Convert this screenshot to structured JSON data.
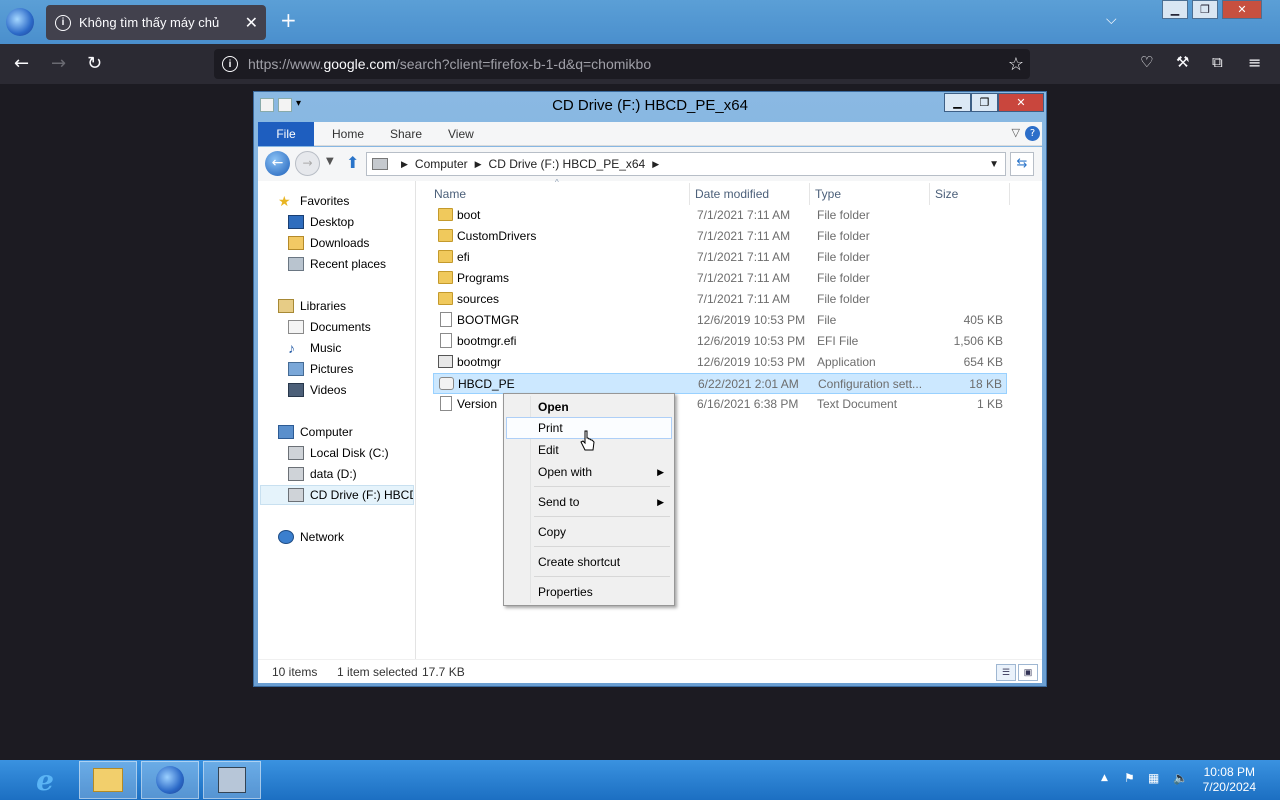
{
  "browser": {
    "tab_title": "Không tìm thấy máy chủ",
    "tab_close": "✕",
    "new_tab": "+",
    "url_prefix": "https://www.",
    "url_domain": "google.com",
    "url_path": "/search?client=firefox-b-1-d&q=chomikbo"
  },
  "window": {
    "title": "CD Drive (F:) HBCD_PE_x64",
    "ribbon_tabs": [
      "File",
      "Home",
      "Share",
      "View"
    ],
    "breadcrumb": [
      "Computer",
      "CD Drive (F:) HBCD_PE_x64"
    ]
  },
  "navpane": {
    "favorites": "Favorites",
    "desktop": "Desktop",
    "downloads": "Downloads",
    "recent": "Recent places",
    "libraries": "Libraries",
    "documents": "Documents",
    "music": "Music",
    "pictures": "Pictures",
    "videos": "Videos",
    "computer": "Computer",
    "local_disk": "Local Disk (C:)",
    "data": "data (D:)",
    "cd_drive": "CD Drive (F:) HBCD_",
    "network": "Network"
  },
  "columns": {
    "name": "Name",
    "date": "Date modified",
    "type": "Type",
    "size": "Size"
  },
  "files": [
    {
      "name": "boot",
      "date": "7/1/2021 7:11 AM",
      "type": "File folder",
      "size": "",
      "icon": "folder-icon"
    },
    {
      "name": "CustomDrivers",
      "date": "7/1/2021 7:11 AM",
      "type": "File folder",
      "size": "",
      "icon": "folder-icon"
    },
    {
      "name": "efi",
      "date": "7/1/2021 7:11 AM",
      "type": "File folder",
      "size": "",
      "icon": "folder-icon"
    },
    {
      "name": "Programs",
      "date": "7/1/2021 7:11 AM",
      "type": "File folder",
      "size": "",
      "icon": "folder-icon"
    },
    {
      "name": "sources",
      "date": "7/1/2021 7:11 AM",
      "type": "File folder",
      "size": "",
      "icon": "folder-icon"
    },
    {
      "name": "BOOTMGR",
      "date": "12/6/2019 10:53 PM",
      "type": "File",
      "size": "405 KB",
      "icon": "file-icon"
    },
    {
      "name": "bootmgr.efi",
      "date": "12/6/2019 10:53 PM",
      "type": "EFI File",
      "size": "1,506 KB",
      "icon": "file-icon"
    },
    {
      "name": "bootmgr",
      "date": "12/6/2019 10:53 PM",
      "type": "Application",
      "size": "654 KB",
      "icon": "application-icon"
    },
    {
      "name": "HBCD_PE",
      "date": "6/22/2021 2:01 AM",
      "type": "Configuration sett...",
      "size": "18 KB",
      "icon": "config-file-icon"
    },
    {
      "name": "Version",
      "date": "6/16/2021 6:38 PM",
      "type": "Text Document",
      "size": "1 KB",
      "icon": "text-file-icon"
    }
  ],
  "status": {
    "items": "10 items",
    "selected": "1 item selected",
    "size": "17.7 KB"
  },
  "context_menu": {
    "open": "Open",
    "print": "Print",
    "edit": "Edit",
    "open_with": "Open with",
    "send_to": "Send to",
    "copy": "Copy",
    "create_shortcut": "Create shortcut",
    "properties": "Properties"
  },
  "taskbar": {
    "time": "10:08 PM",
    "date": "7/20/2024"
  }
}
